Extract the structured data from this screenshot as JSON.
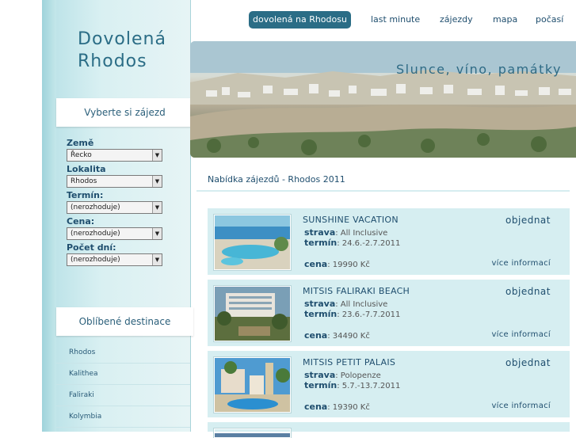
{
  "site": {
    "title_line1": "Dovolená",
    "title_line2": "Rhodos"
  },
  "nav": [
    {
      "label": "dovolená na Rhodosu",
      "active": true
    },
    {
      "label": "last minute"
    },
    {
      "label": "zájezdy"
    },
    {
      "label": "mapa"
    },
    {
      "label": "počasí"
    }
  ],
  "banner": {
    "slogan": "Slunce, víno, památky"
  },
  "sidebar": {
    "filter_heading": "Vyberte si zájezd",
    "filters": [
      {
        "label": "Země",
        "value": "Řecko"
      },
      {
        "label": "Lokalita",
        "value": "Rhodos"
      },
      {
        "label": "Termín:",
        "value": "(nerozhoduje)"
      },
      {
        "label": "Cena:",
        "value": "(nerozhoduje)"
      },
      {
        "label": "Počet dní:",
        "value": "(nerozhoduje)"
      }
    ],
    "dest_heading": "Oblíbené destinace",
    "destinations": [
      "Rhodos",
      "Kalithea",
      "Faliraki",
      "Kolymbia"
    ]
  },
  "main": {
    "section_title": "Nabídka zájezdů - Rhodos 2011",
    "labels": {
      "strava": "strava",
      "termin": "termín",
      "cena": "cena",
      "book": "objednat",
      "more": "více informací"
    },
    "offers": [
      {
        "name": "SUNSHINE VACATION",
        "strava": ": All Inclusive",
        "termin": ": 24.6.-2.7.2011",
        "cena": ": 19990 Kč"
      },
      {
        "name": "MITSIS FALIRAKI BEACH",
        "strava": ": All Inclusive",
        "termin": ": 23.6.-7.7.2011",
        "cena": ": 34490 Kč"
      },
      {
        "name": "MITSIS PETIT PALAIS",
        "strava": ": Polopenze",
        "termin": ": 5.7.-13.7.2011",
        "cena": ": 19390 Kč"
      }
    ]
  }
}
